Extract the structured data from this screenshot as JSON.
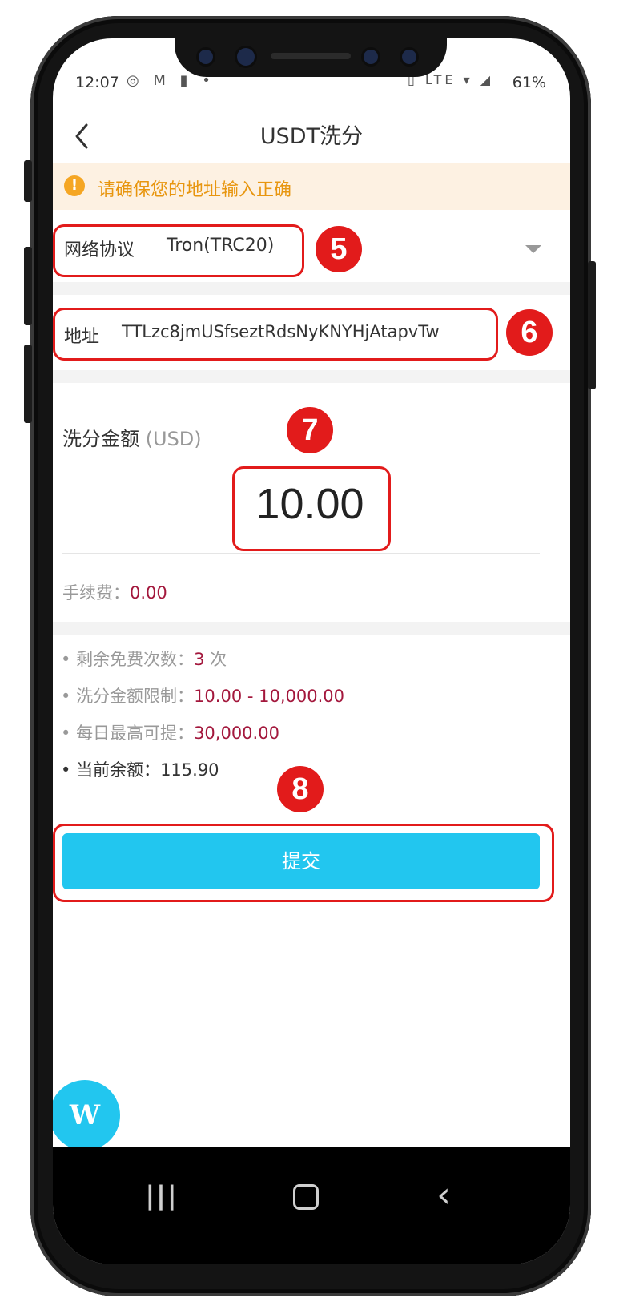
{
  "status_bar": {
    "time": "12:07",
    "left_icons": "◎ M ▮ •",
    "right_icons": "▯ LTE ▾ ◢",
    "battery": "61%"
  },
  "header": {
    "title": "USDT洗分",
    "back_icon": "chevron-left"
  },
  "warning": {
    "text": "请确保您的地址输入正确",
    "icon": "!"
  },
  "network": {
    "label": "网络协议",
    "value": "Tron(TRC20)"
  },
  "address": {
    "label": "地址",
    "value": "TTLzc8jmUSfseztRdsNyKNYHjAtapvTw"
  },
  "amount": {
    "label": "洗分金额",
    "unit": "(USD)",
    "value": "10.00"
  },
  "fee": {
    "label": "手续费：",
    "value": "0.00"
  },
  "info": [
    {
      "label": "剩余免费次数：",
      "value": "3",
      "suffix": " 次"
    },
    {
      "label": "洗分金额限制：",
      "value": "10.00 - 10,000.00"
    },
    {
      "label": "每日最高可提：",
      "value": "30,000.00"
    },
    {
      "label": "当前余额：",
      "value": "115.90"
    }
  ],
  "submit": {
    "label": "提交"
  },
  "annotations": [
    "5",
    "6",
    "7",
    "8"
  ],
  "float_logo": {
    "text": "W"
  },
  "nav": {
    "recent": "|||",
    "back": "‹"
  },
  "colors": {
    "accent": "#22c6ef",
    "warning_bg": "#fdf1e2",
    "warning_text": "#e8960f",
    "value_red": "#a3173c",
    "annotation": "#e21b1b"
  }
}
